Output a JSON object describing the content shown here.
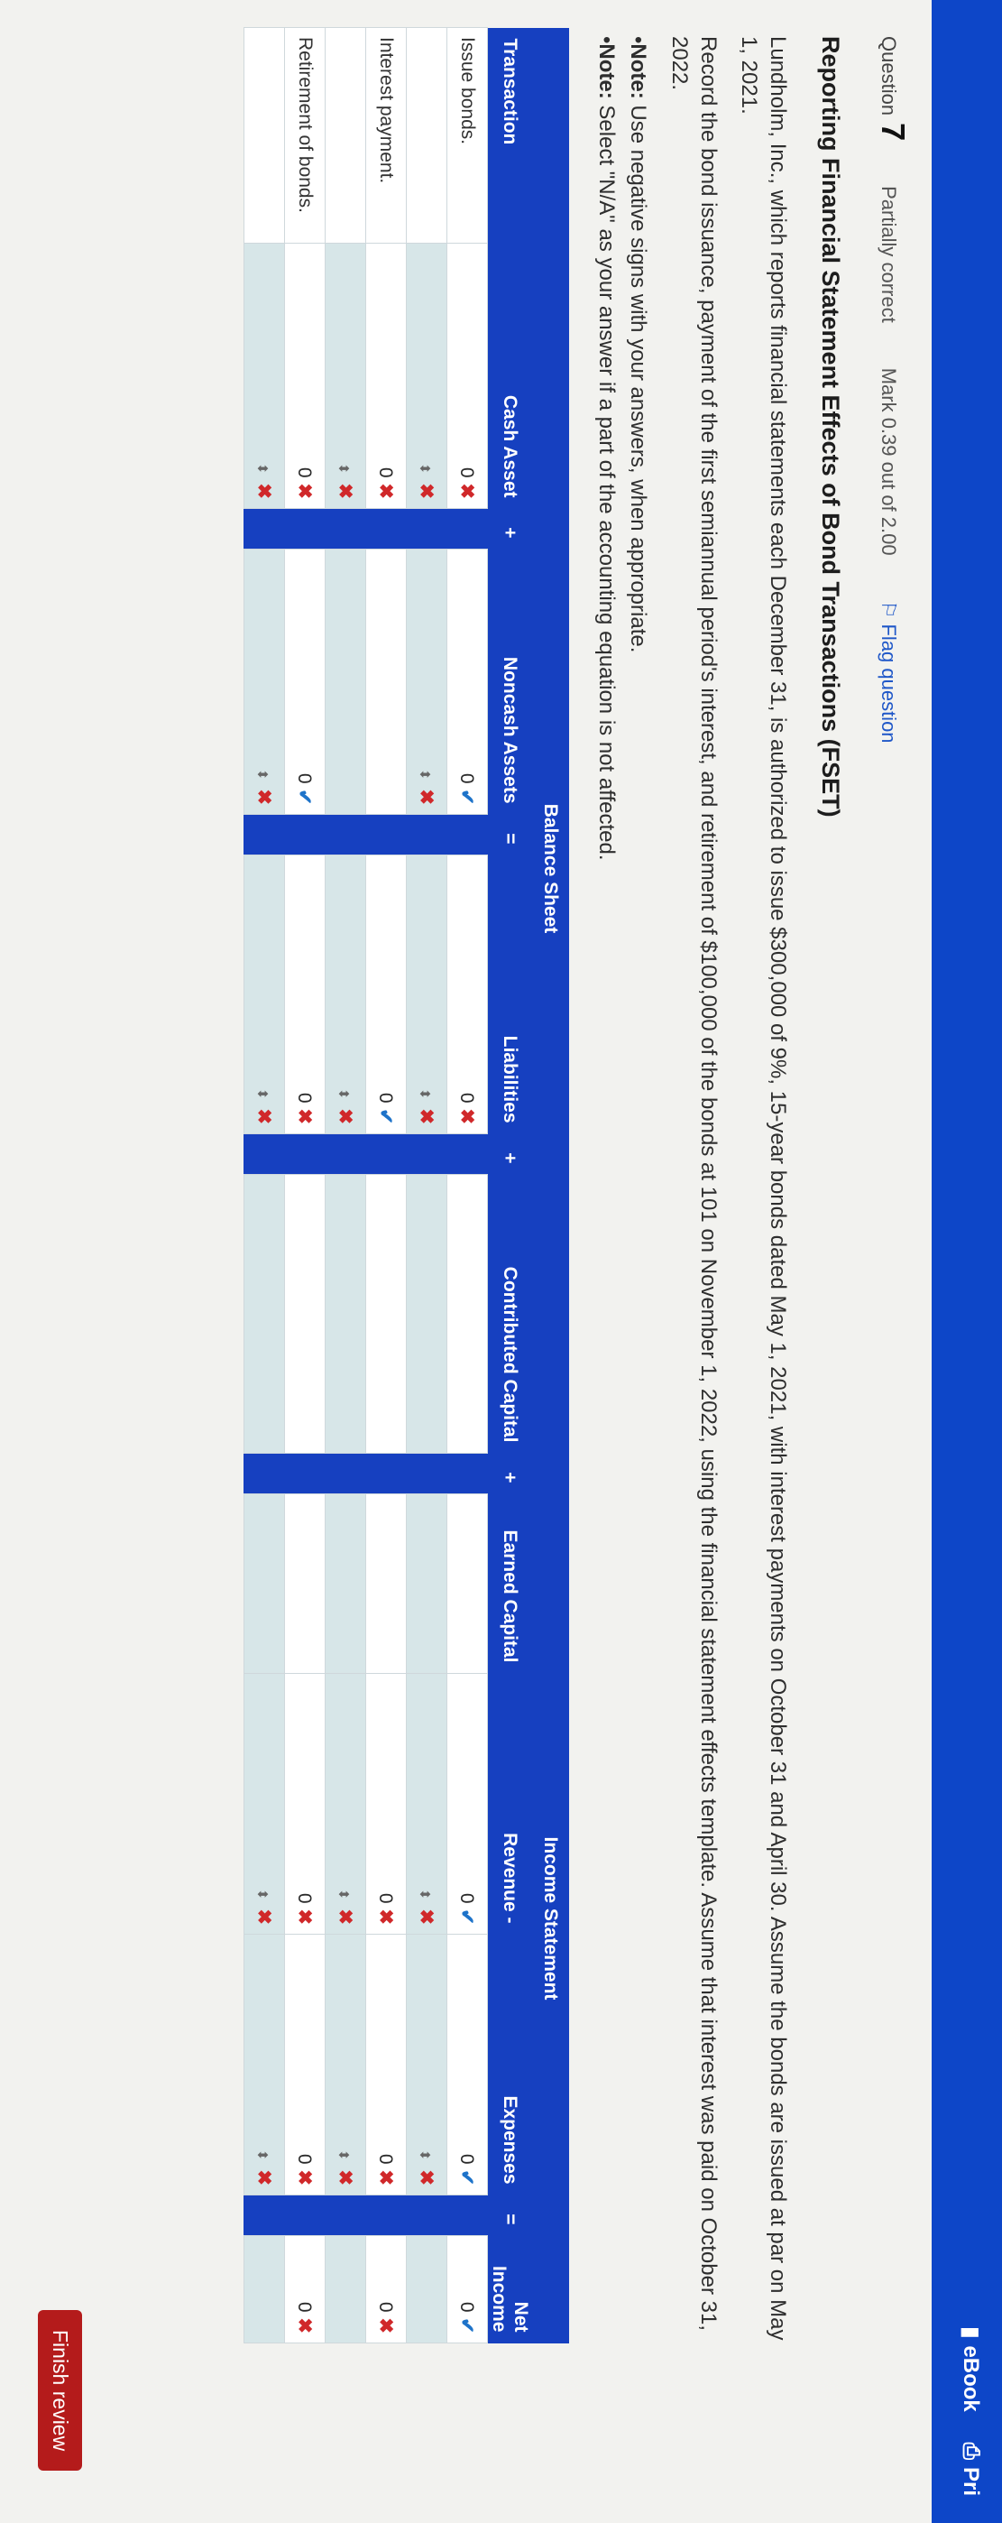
{
  "header": {
    "ebook": "eBook",
    "print": "Pri"
  },
  "question": {
    "label": "Question",
    "number": "7",
    "status": "Partially correct",
    "mark": "Mark 0.39 out of 2.00",
    "flag": "Flag question"
  },
  "title": "Reporting Financial Statement Effects of Bond Transactions (FSET)",
  "paragraphs": {
    "p1": "Lundholm, Inc., which reports financial statements each December 31, is authorized to issue $300,000 of 9%, 15-year bonds dated May 1, 2021, with interest payments on October 31 and April 30. Assume the bonds are issued at par on May 1, 2021.",
    "p2": "Record the bond issuance, payment of the first semiannual period's interest, and retirement of $100,000 of the bonds at 101 on November 1, 2022, using the financial statement effects template. Assume that interest was paid on October 31, 2022."
  },
  "notes": {
    "n1_label": "Note:",
    "n1_text": " Use negative signs with your answers, when appropriate.",
    "n2_label": "Note:",
    "n2_text": " Select \"N/A\" as your answer if a part of the accounting equation is not affected."
  },
  "table": {
    "group_balance": "Balance Sheet",
    "group_income": "Income Statement",
    "headers": {
      "transaction": "Transaction",
      "cash": "Cash Asset",
      "noncash": "Noncash Assets",
      "liabilities": "Liabilities",
      "contributed": "Contributed Capital",
      "earned": "Earned Capital",
      "revenue": "Revenue",
      "expenses": "Expenses",
      "net": "Net Income"
    },
    "ops": {
      "plus": "+",
      "eq": "=",
      "minus": "-"
    },
    "rows": [
      {
        "label": "Issue bonds.",
        "values": {
          "cash": "0",
          "noncash": "0",
          "liabilities": "0",
          "contributed": "",
          "earned": "",
          "revenue": "0",
          "expenses": "0",
          "net": "0"
        },
        "marks": {
          "cash": "✖",
          "noncash": "✔",
          "liabilities": "✖",
          "revenue": "✔",
          "expenses": "✔",
          "net": "✔"
        },
        "selects": {
          "cash": "✖",
          "noncash": "✖",
          "liabilities": "✖",
          "revenue": "✖",
          "expenses": "✖"
        }
      },
      {
        "label": "Interest payment.",
        "values": {
          "cash": "0",
          "noncash": "",
          "liabilities": "0",
          "contributed": "",
          "earned": "",
          "revenue": "0",
          "expenses": "0",
          "net": "0"
        },
        "marks": {
          "cash": "✖",
          "liabilities": "✔",
          "revenue": "✖",
          "expenses": "✖",
          "net": "✖"
        },
        "selects": {
          "cash": "✖",
          "liabilities": "✖",
          "revenue": "✖",
          "expenses": "✖"
        }
      },
      {
        "label": "Retirement of bonds.",
        "values": {
          "cash": "0",
          "noncash": "0",
          "liabilities": "0",
          "contributed": "",
          "earned": "",
          "revenue": "0",
          "expenses": "0",
          "net": "0"
        },
        "marks": {
          "cash": "✖",
          "noncash": "✔",
          "liabilities": "✖",
          "revenue": "✖",
          "expenses": "✖",
          "net": "✖"
        },
        "selects": {
          "cash": "✖",
          "noncash": "✖",
          "liabilities": "✖",
          "revenue": "✖",
          "expenses": "✖"
        }
      }
    ]
  },
  "finish_label": "Finish review",
  "colors": {
    "topbar": "#0d46c8",
    "header": "#1640c0",
    "correct": "#1e73c9",
    "incorrect": "#d0282a",
    "finish": "#b41b1b"
  }
}
